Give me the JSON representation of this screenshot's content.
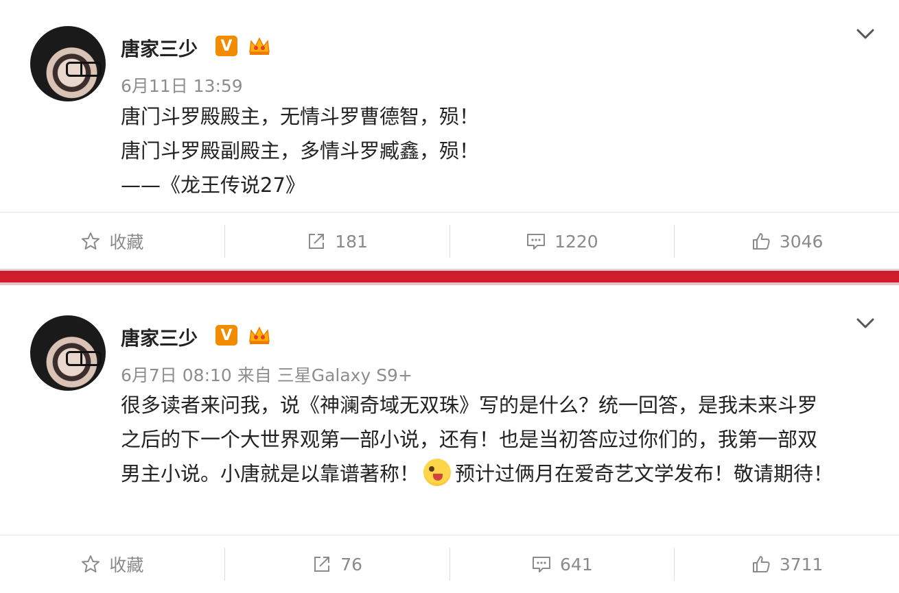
{
  "posts": [
    {
      "author": "唐家三少",
      "badge_v": "V",
      "meta": "6月11日 13:59",
      "lines": [
        "唐门斗罗殿殿主，无情斗罗曹德智，殒！",
        "唐门斗罗殿副殿主，多情斗罗臧鑫，殒！",
        "——《龙王传说27》"
      ],
      "actions": {
        "favorite": "收藏",
        "repost": "181",
        "comment": "1220",
        "like": "3046"
      }
    },
    {
      "author": "唐家三少",
      "badge_v": "V",
      "meta": "6月7日 08:10 来自 三星Galaxy S9+",
      "lines": [
        "很多读者来问我，说《神澜奇域无双珠》写的是什么？统一回答，是我未来斗罗",
        "之后的下一个大世界观第一部小说，还有！也是当初答应过你们的，我第一部双",
        "男主小说。小唐就是以靠谱著称！",
        "预计过俩月在爱奇艺文学发布！敬请期待！"
      ],
      "actions": {
        "favorite": "收藏",
        "repost": "76",
        "comment": "641",
        "like": "3711"
      }
    }
  ],
  "colors": {
    "accent_red": "#d01d2b",
    "badge_orange": "#f38b00",
    "meta_gray": "#8d8d8d"
  },
  "icons": [
    "star-icon",
    "repost-icon",
    "comment-icon",
    "like-icon",
    "chevron-down-icon",
    "crown-icon"
  ]
}
